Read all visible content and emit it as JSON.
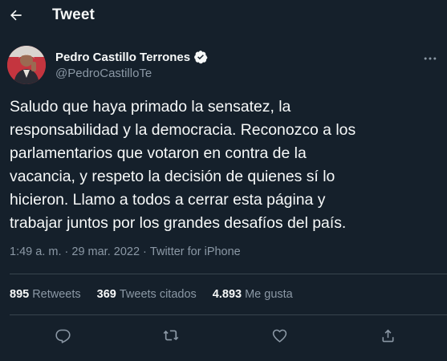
{
  "header": {
    "title": "Tweet",
    "back_icon": "arrow-left-icon"
  },
  "author": {
    "name": "Pedro Castillo Terrones",
    "handle": "@PedroCastilloTe",
    "verified_icon": "verified-badge-icon",
    "more_icon": "more-horizontal-icon"
  },
  "tweet": {
    "text": "Saludo que haya primado la sensatez, la\nresponsabilidad y la democracia. Reconozco a los\nparlamentarios que votaron en contra de la\nvacancia, y respeto la decisión de quienes sí lo\nhicieron. Llamo a todos a cerrar esta página y\ntrabajar juntos por los grandes desafíos del país.",
    "time": "1:49 a. m.",
    "separator1": " · ",
    "date": "29 mar. 2022",
    "separator2": " · ",
    "source": "Twitter for iPhone"
  },
  "stats": {
    "retweets_count": "895",
    "retweets_label": "Retweets",
    "quotes_count": "369",
    "quotes_label": "Tweets citados",
    "likes_count": "4.893",
    "likes_label": "Me gusta"
  },
  "actions": {
    "reply_icon": "reply-icon",
    "retweet_icon": "retweet-icon",
    "like_icon": "heart-icon",
    "share_icon": "share-icon"
  },
  "colors": {
    "background": "#15202b",
    "text": "#f7f9f9",
    "secondary": "#8b98a5",
    "divider": "#38444d",
    "verified": "#1d9bf0"
  }
}
